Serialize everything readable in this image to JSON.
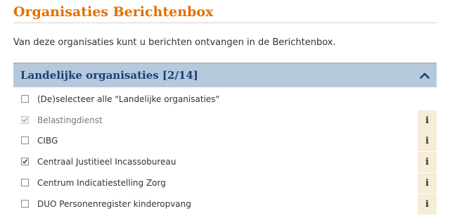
{
  "page": {
    "title": "Organisaties Berichtenbox",
    "intro": "Van deze organisaties kunt u berichten ontvangen in de Berichtenbox."
  },
  "section": {
    "title": "Landelijke organisaties [2/14]",
    "expanded": true,
    "toggle_icon": "chevron-up-icon",
    "select_all_label": "(De)selecteer alle \"Landelijke organisaties\"",
    "select_all_checked": false,
    "items": [
      {
        "label": "Belastingdienst",
        "checked": true,
        "disabled": true,
        "info_icon": "i"
      },
      {
        "label": "CIBG",
        "checked": false,
        "disabled": false,
        "info_icon": "i"
      },
      {
        "label": "Centraal Justitieel Incassobureau",
        "checked": true,
        "disabled": false,
        "info_icon": "i"
      },
      {
        "label": "Centrum Indicatiestelling Zorg",
        "checked": false,
        "disabled": false,
        "info_icon": "i"
      },
      {
        "label": "DUO Personenregister kinderopvang",
        "checked": false,
        "disabled": false,
        "info_icon": "i"
      }
    ]
  },
  "colors": {
    "title": "#e17000",
    "section_header_bg": "#b6c8db",
    "section_title": "#154273",
    "info_bg": "#f6ecd8"
  }
}
